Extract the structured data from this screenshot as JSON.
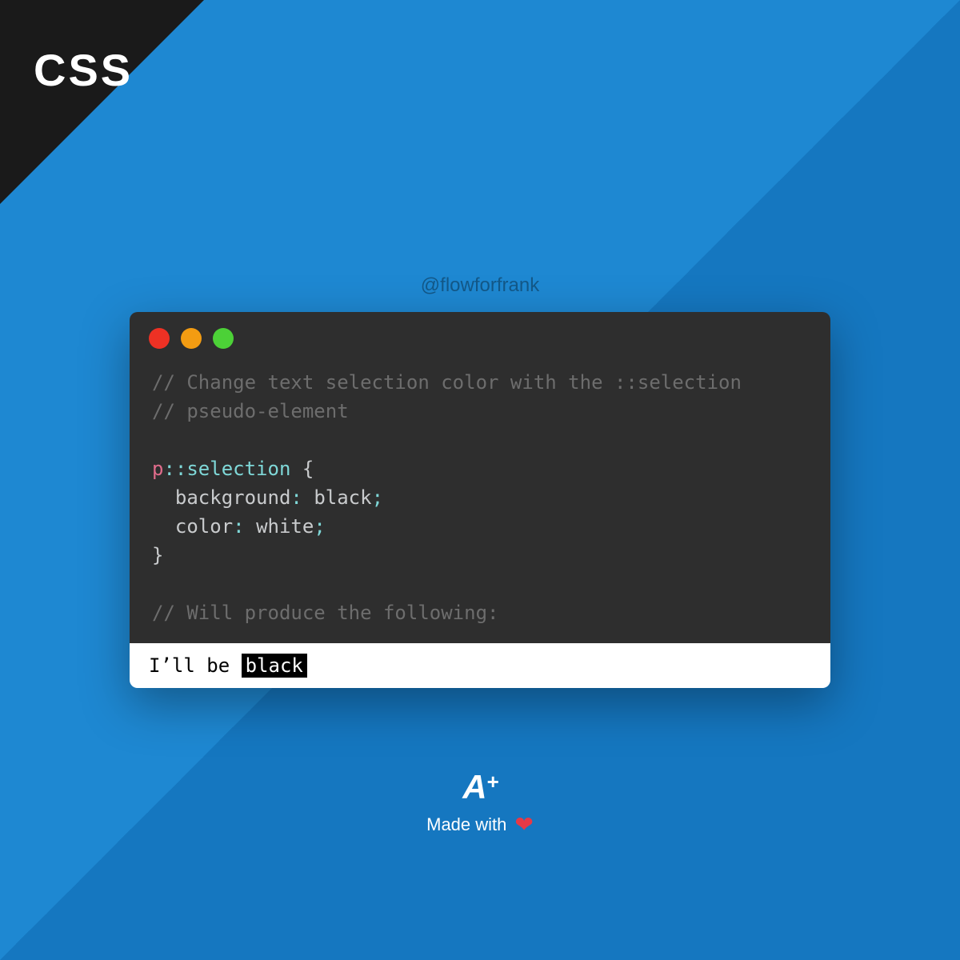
{
  "corner": {
    "label": "CSS"
  },
  "watermark": "@flowforfrank",
  "code": {
    "comment1": "// Change text selection color with the ::selection",
    "comment2": "// pseudo-element",
    "selector_tag": "p",
    "selector_pseudo": "::",
    "selector_name": "selection",
    "brace_open": " {",
    "prop1_name": "background",
    "prop1_value": "black",
    "prop2_name": "color",
    "prop2_value": "white",
    "brace_close": "}",
    "comment3": "// Will produce the following:"
  },
  "output": {
    "prefix": "I’ll be ",
    "highlighted": "black"
  },
  "footer": {
    "logo_letter": "A",
    "logo_plus": "+",
    "made_with": "Made with",
    "heart": "❤"
  },
  "colors": {
    "bg_light": "#1e88d2",
    "bg_dark": "#1577c0",
    "window": "#2e2e2e",
    "dot_red": "#ee3124",
    "dot_amber": "#f39c12",
    "dot_green": "#4cd137"
  }
}
